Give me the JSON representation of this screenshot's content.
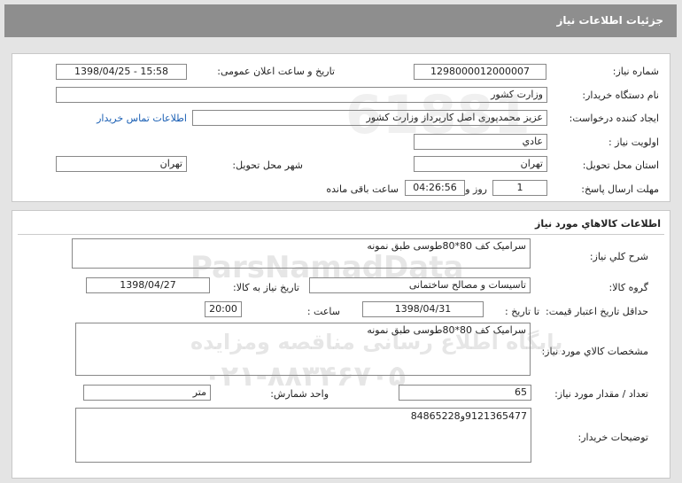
{
  "header": {
    "title": "جزئیات اطلاعات نیاز"
  },
  "info": {
    "need_number_label": "شماره نیاز:",
    "need_number": "1298000012000007",
    "announce_label": "تاریخ و ساعت اعلان عمومی:",
    "announce_value": "1398/04/25 - 15:58",
    "buyer_org_label": "نام دستگاه خریدار:",
    "buyer_org": "وزارت کشور",
    "creator_label": "ایجاد کننده درخواست:",
    "creator": "عزیز محمدپوری اصل کارپرداز وزارت کشور",
    "contact_link": "اطلاعات تماس خریدار",
    "priority_label": "اولویت نیاز :",
    "priority": "عادي",
    "province_label": "استان محل تحویل:",
    "province": "تهران",
    "city_label": "شهر محل تحویل:",
    "city": "تهران",
    "deadline_label": "مهلت ارسال پاسخ:",
    "days": "1",
    "days_suffix": "روز و",
    "time": "04:26:56",
    "time_suffix": "ساعت باقی مانده"
  },
  "goods": {
    "section_title": "اطلاعات کالاهاي مورد نياز",
    "general_desc_label": "شرح کلي نياز:",
    "general_desc": "سرامیک کف 80*80طوسی طبق نمونه",
    "group_label": "گروه کالا:",
    "group": "تاسیسات و مصالح ساختمانی",
    "need_date_label": "تاریخ نیاز به کالا:",
    "need_date": "1398/04/27",
    "min_validity_label": "حداقل تاریخ اعتبار قیمت:",
    "until_date_label": "تا تاریخ :",
    "until_date": "1398/04/31",
    "hour_label": "ساعت :",
    "hour": "20:00",
    "specs_label": "مشخصات کالاي مورد نياز:",
    "specs": "سرامیک کف 80*80طوسی طبق نمونه",
    "qty_label": "تعداد / مقدار مورد نياز:",
    "qty": "65",
    "unit_label": "واحد شمارش:",
    "unit": "متر",
    "buyer_notes_label": "توضيحات خريدار:",
    "buyer_notes": "9121365477و84865228"
  },
  "watermark": {
    "line1": "ParsNamadData",
    "line2": "پایگاه اطلاع رسانی مناقصه ومزایده",
    "line3": "۰۲۱-۸۸۳۴۶۷۰۵",
    "line4": "61881"
  }
}
